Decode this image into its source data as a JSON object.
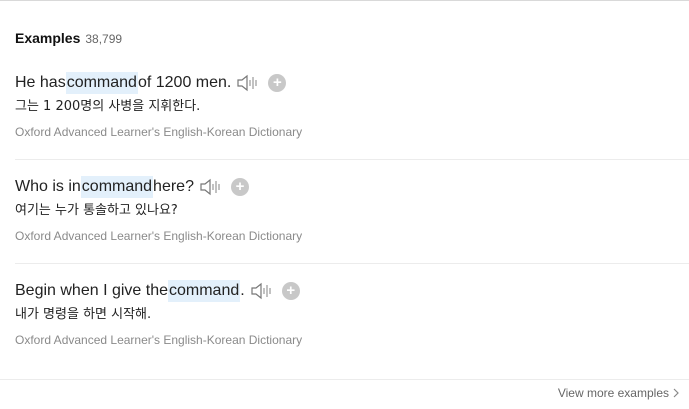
{
  "section": {
    "title": "Examples",
    "count": "38,799"
  },
  "examples": [
    {
      "before": "He has ",
      "keyword": "command",
      "after": " of 1200 men.",
      "translation": "그는 1 200명의 사병을 지휘한다.",
      "source": "Oxford Advanced Learner's English-Korean Dictionary"
    },
    {
      "before": "Who is in ",
      "keyword": "command",
      "after": " here?",
      "translation": "여기는 누가 통솔하고 있나요?",
      "source": "Oxford Advanced Learner's English-Korean Dictionary"
    },
    {
      "before": "Begin when I give the ",
      "keyword": "command",
      "after": ".",
      "translation": "내가 명령을 하면 시작해.",
      "source": "Oxford Advanced Learner's English-Korean Dictionary"
    }
  ],
  "icons": {
    "sound": "speaker-icon",
    "add": "plus-circle-icon",
    "chevron": "chevron-right-icon"
  },
  "add_symbol": "+",
  "view_more": {
    "label": "View more examples"
  },
  "colors": {
    "highlight": "#e3f0fb",
    "source_text": "#8a8a8a",
    "add_button": "#c8c8c8"
  }
}
